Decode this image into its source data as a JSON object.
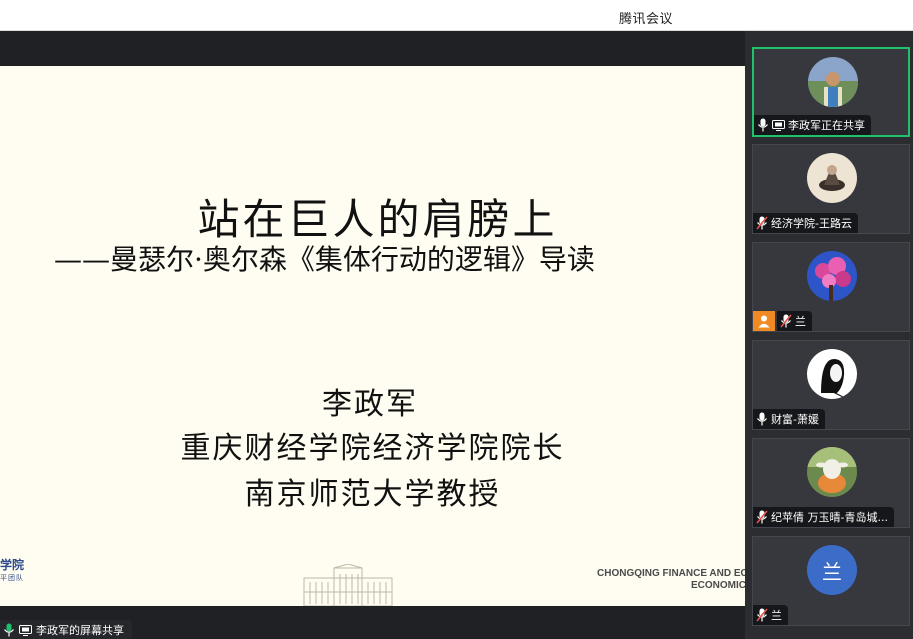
{
  "window": {
    "title": "腾讯会议"
  },
  "slide": {
    "title": "站在巨人的肩膀上",
    "subtitle": "——曼瑟尔·奥尔森《集体行动的逻辑》导读",
    "presenter_name": "李政军",
    "presenter_title_1": "重庆财经学院经济学院院长",
    "presenter_title_2": "南京师范大学教授",
    "logo_text_top": "学院",
    "logo_text_bottom": "平团队",
    "footer_line1": "CHONGQING FINANCE AND ECO",
    "footer_line2": "ECONOMICS"
  },
  "screen_share_tag": {
    "label": "李政军的屏幕共享"
  },
  "participants": [
    {
      "name": "李政军正在共享",
      "mic": "on",
      "sharing": true,
      "active": true,
      "avatar": "photo-man-outdoor"
    },
    {
      "name": "经济学院-王路云",
      "mic": "muted",
      "avatar": "photo-figure"
    },
    {
      "name": "兰",
      "mic": "muted",
      "host": true,
      "avatar": "photo-pink-flowers"
    },
    {
      "name": "财富-萧媛",
      "mic": "on",
      "avatar": "photo-woman-sketch"
    },
    {
      "name": "纪苹倩 万玉晴-青岛城...",
      "mic": "muted",
      "avatar": "photo-sheep"
    },
    {
      "name": "兰",
      "mic": "muted",
      "avatar_letter": "兰",
      "avatar_color": "#3b6cc7"
    }
  ],
  "colors": {
    "active_border": "#1fc26b",
    "muted_mic": "#e5534b",
    "host_badge": "#f08a24"
  }
}
